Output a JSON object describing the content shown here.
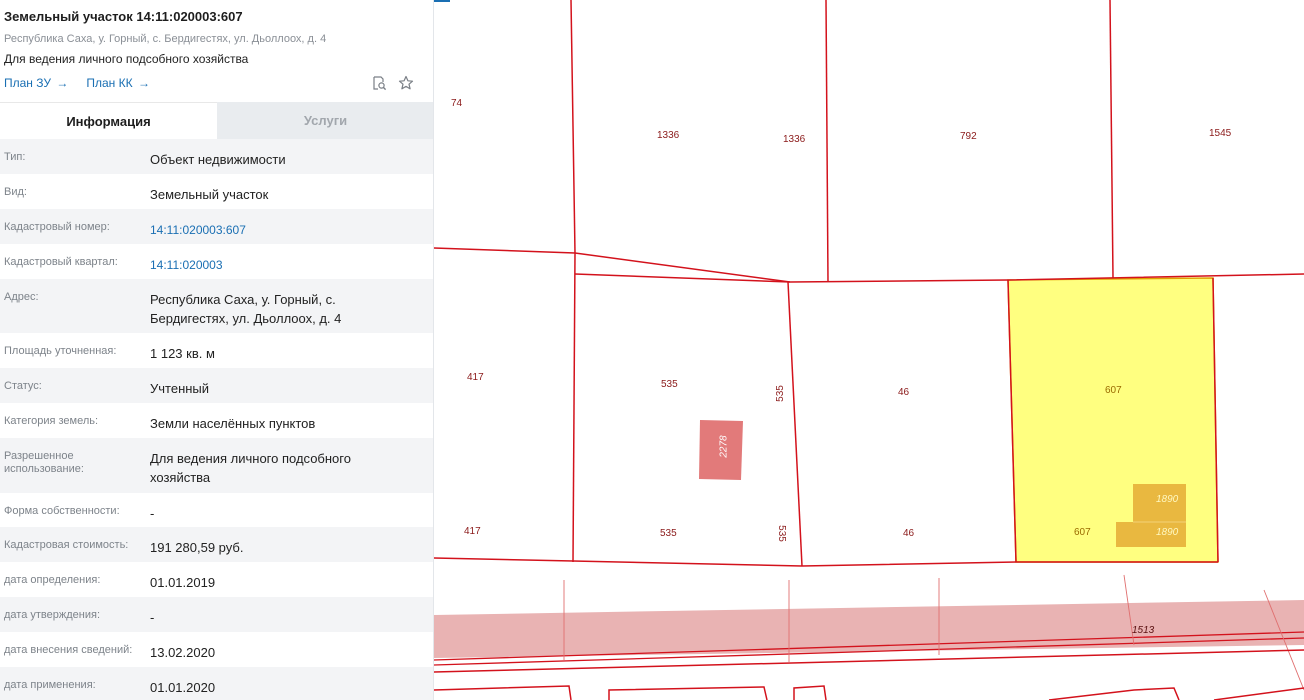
{
  "header": {
    "title": "Земельный участок 14:11:020003:607",
    "address": "Республика Саха, у. Горный, с. Бердигестях, ул. Дьоллоох, д. 4",
    "usage": "Для ведения личного подсобного хозяйства",
    "links": [
      {
        "label": "План ЗУ",
        "arrow": "→"
      },
      {
        "label": "План КК",
        "arrow": "→"
      }
    ],
    "icons": [
      "search-document-icon",
      "star-icon"
    ]
  },
  "tabs": [
    {
      "label": "Информация",
      "active": true
    },
    {
      "label": "Услуги",
      "active": false
    }
  ],
  "info_rows": [
    {
      "label": "Тип:",
      "value": "Объект недвижимости",
      "link": false
    },
    {
      "label": "Вид:",
      "value": "Земельный участок",
      "link": false
    },
    {
      "label": "Кадастровый номер:",
      "value": "14:11:020003:607",
      "link": true
    },
    {
      "label": "Кадастровый квартал:",
      "value": "14:11:020003",
      "link": true
    },
    {
      "label": "Адрес:",
      "value": "Республика Саха, у. Горный, с. Бердигестях, ул. Дьоллоох, д. 4",
      "link": false
    },
    {
      "label": "Площадь уточненная:",
      "value": "1 123 кв. м",
      "link": false
    },
    {
      "label": "Статус:",
      "value": "Учтенный",
      "link": false
    },
    {
      "label": "Категория земель:",
      "value": "Земли населённых пунктов",
      "link": false
    },
    {
      "label": "Разрешенное использование:",
      "value": "Для ведения личного подсобного хозяйства",
      "link": false
    },
    {
      "label": "Форма собственности:",
      "value": "-",
      "link": false
    },
    {
      "label": "Кадастровая стоимость:",
      "value": "191 280,59 руб.",
      "link": false
    },
    {
      "label": "дата определения:",
      "value": "01.01.2019",
      "link": false
    },
    {
      "label": "дата утверждения:",
      "value": "-",
      "link": false
    },
    {
      "label": "дата внесения сведений:",
      "value": "13.02.2020",
      "link": false
    },
    {
      "label": "дата применения:",
      "value": "01.01.2020",
      "link": false
    }
  ],
  "map": {
    "parcel_labels": {
      "p74": "74",
      "p1336a": "1336",
      "p1336b": "1336",
      "p792": "792",
      "p1545": "1545",
      "p417a": "417",
      "p535a": "535",
      "p535v1": "535",
      "p46a": "46",
      "p607a": "607",
      "p2278": "2278",
      "p1890a": "1890",
      "p1890b": "1890",
      "p417b": "417",
      "p535b": "535",
      "p535v2": "535",
      "p46b": "46",
      "p607b": "607",
      "p1513": "1513"
    },
    "colors": {
      "boundary": "#d3121c",
      "selected_fill": "#ffff80",
      "building_fill": "#e9b840",
      "road_fill": "#e9b3b3",
      "small_building_fill": "#e27a7a"
    }
  }
}
